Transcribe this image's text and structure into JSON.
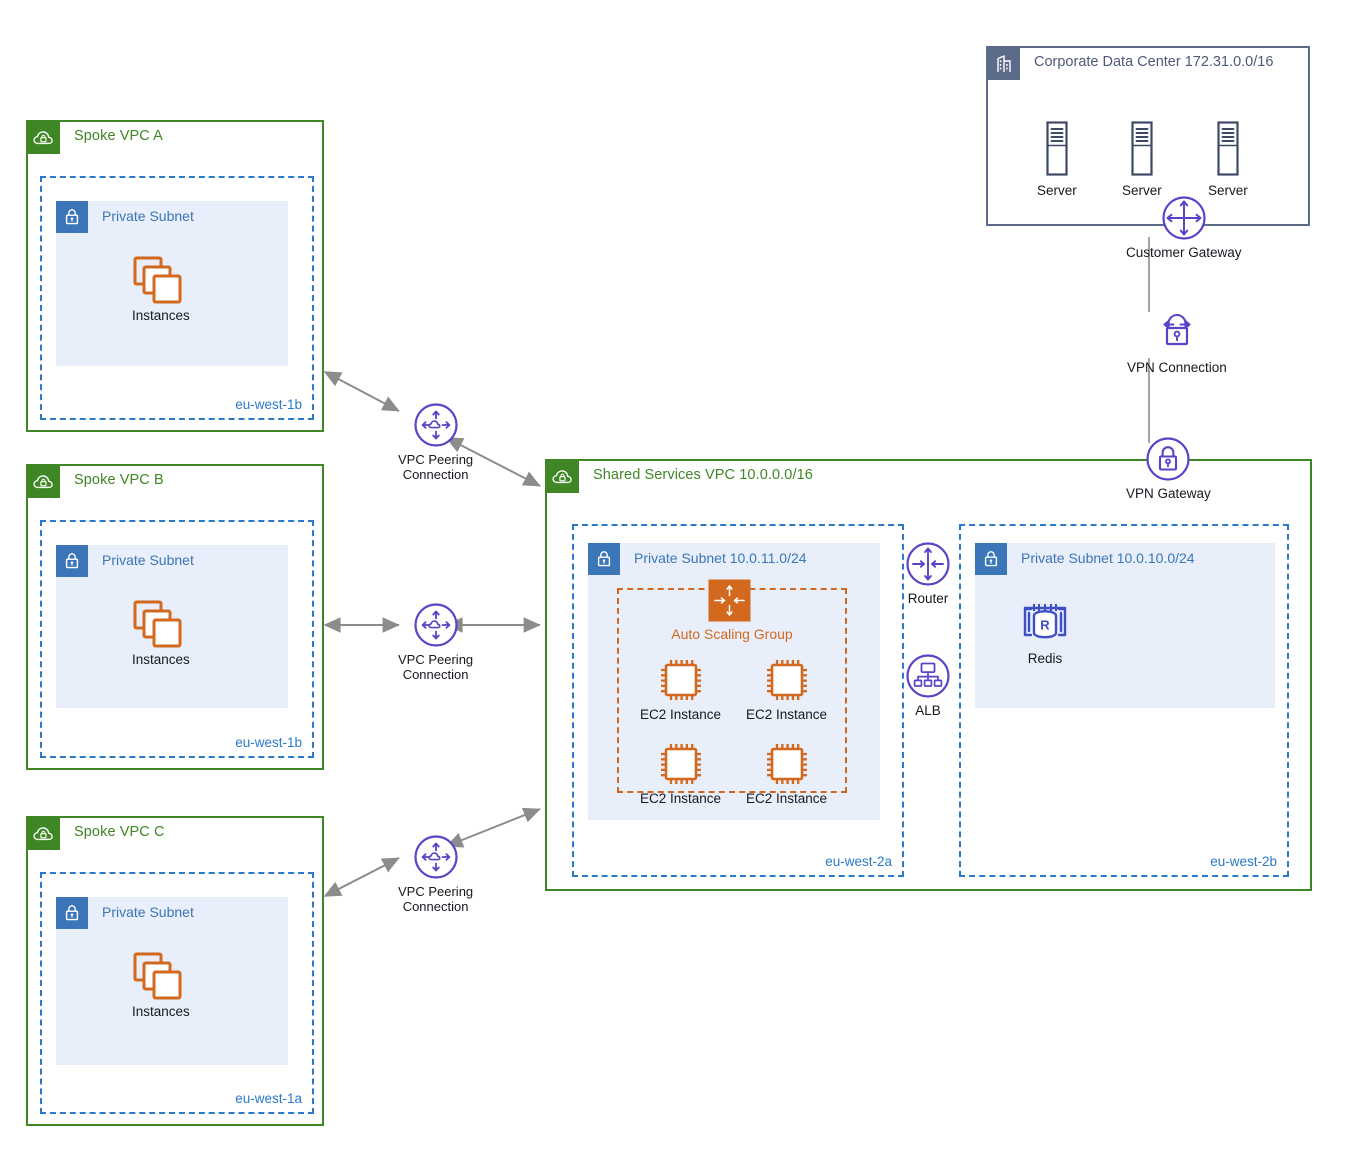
{
  "diagram": {
    "title": "AWS hub-and-spoke VPC peering architecture",
    "colors": {
      "vpc_green": "#3f8624",
      "subnet_blue": "#3a76b8",
      "az_dashed_blue": "#2a7ac9",
      "subnet_fill": "#e9effa",
      "asg_orange": "#d2691e",
      "aws_purple": "#5c42c6",
      "datacenter_grey": "#5d6b8a",
      "wire_grey": "#8c8c8c"
    }
  },
  "spokes": [
    {
      "vpc_title": "Spoke VPC A",
      "vpc_icon": "vpc-cloud-lock-icon",
      "az_label": "eu-west-1b",
      "subnet_title": "Private Subnet",
      "subnet_icon": "private-subnet-lock-icon",
      "instances_label": "Instances",
      "instances_icon": "ec2-instances-stack-icon"
    },
    {
      "vpc_title": "Spoke VPC B",
      "vpc_icon": "vpc-cloud-lock-icon",
      "az_label": "eu-west-1b",
      "subnet_title": "Private Subnet",
      "subnet_icon": "private-subnet-lock-icon",
      "instances_label": "Instances",
      "instances_icon": "ec2-instances-stack-icon"
    },
    {
      "vpc_title": "Spoke VPC C",
      "vpc_icon": "vpc-cloud-lock-icon",
      "az_label": "eu-west-1a",
      "subnet_title": "Private Subnet",
      "subnet_icon": "private-subnet-lock-icon",
      "instances_label": "Instances",
      "instances_icon": "ec2-instances-stack-icon"
    }
  ],
  "peering": [
    {
      "line1": "VPC Peering",
      "line2": "Connection",
      "icon": "vpc-peering-connection-icon"
    },
    {
      "line1": "VPC Peering",
      "line2": "Connection",
      "icon": "vpc-peering-connection-icon"
    },
    {
      "line1": "VPC Peering",
      "line2": "Connection",
      "icon": "vpc-peering-connection-icon"
    }
  ],
  "shared_vpc": {
    "title": "Shared Services VPC 10.0.0.0/16",
    "icon": "vpc-cloud-lock-icon",
    "az_a": {
      "az_label": "eu-west-2a",
      "subnet_title": "Private Subnet 10.0.11.0/24",
      "subnet_icon": "private-subnet-lock-icon",
      "asg": {
        "title": "Auto Scaling Group",
        "icon": "auto-scaling-group-icon",
        "instances": [
          {
            "label": "EC2 Instance",
            "icon": "ec2-instance-icon"
          },
          {
            "label": "EC2 Instance",
            "icon": "ec2-instance-icon"
          },
          {
            "label": "EC2 Instance",
            "icon": "ec2-instance-icon"
          },
          {
            "label": "EC2 Instance",
            "icon": "ec2-instance-icon"
          }
        ]
      }
    },
    "az_b": {
      "az_label": "eu-west-2b",
      "subnet_title": "Private Subnet 10.0.10.0/24",
      "subnet_icon": "private-subnet-lock-icon",
      "cache": {
        "label": "Redis",
        "icon": "elasticache-redis-icon"
      }
    },
    "router": {
      "label": "Router",
      "icon": "router-icon"
    },
    "alb": {
      "label": "ALB",
      "icon": "application-load-balancer-icon"
    }
  },
  "datacenter": {
    "title": "Corporate Data Center 172.31.0.0/16",
    "icon": "corporate-data-center-icon",
    "servers": [
      {
        "label": "Server",
        "icon": "server-icon"
      },
      {
        "label": "Server",
        "icon": "server-icon"
      },
      {
        "label": "Server",
        "icon": "server-icon"
      }
    ],
    "customer_gateway": {
      "label": "Customer Gateway",
      "icon": "customer-gateway-icon"
    }
  },
  "vpn": {
    "connection": {
      "label": "VPN Connection",
      "icon": "vpn-connection-icon"
    },
    "gateway": {
      "label": "VPN Gateway",
      "icon": "vpn-gateway-icon"
    }
  }
}
